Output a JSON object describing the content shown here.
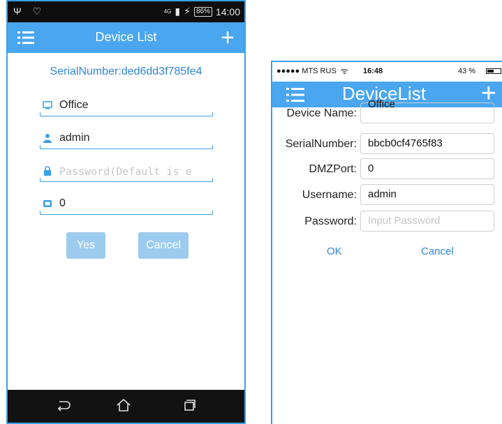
{
  "android": {
    "status": {
      "left_icons": "Ψ ♡",
      "network": "4G",
      "battery": "86%",
      "time": "14:00"
    },
    "title": "Device List",
    "serial": "SerialNumber:ded6dd3f785fe4",
    "fields": {
      "device_name": "Office",
      "username": "admin",
      "password_placeholder": "Password(Default is e",
      "port": "0"
    },
    "buttons": {
      "yes": "Yes",
      "cancel": "Cancel"
    },
    "icons": {
      "name": "monitor-icon",
      "user": "user-icon",
      "password": "lock-icon",
      "port": "port-icon"
    }
  },
  "ios": {
    "status": {
      "carrier": "●●●●● MTS RUS",
      "time": "16:48",
      "battery": "43 %"
    },
    "title": "DeviceList",
    "form": {
      "device_name_label": "Device Name:",
      "device_name_value": "Office",
      "serial_label": "SerialNumber:",
      "serial_value": "bbcb0cf4765f83",
      "port_label": "DMZPort:",
      "port_value": "0",
      "username_label": "Username:",
      "username_value": "admin",
      "password_label": "Password:",
      "password_placeholder": "Input Password"
    },
    "buttons": {
      "ok": "OK",
      "cancel": "Cancel"
    }
  },
  "colors": {
    "accent": "#4aa6ee",
    "link": "#2f86d6",
    "button_disabled": "#9ccbee"
  }
}
